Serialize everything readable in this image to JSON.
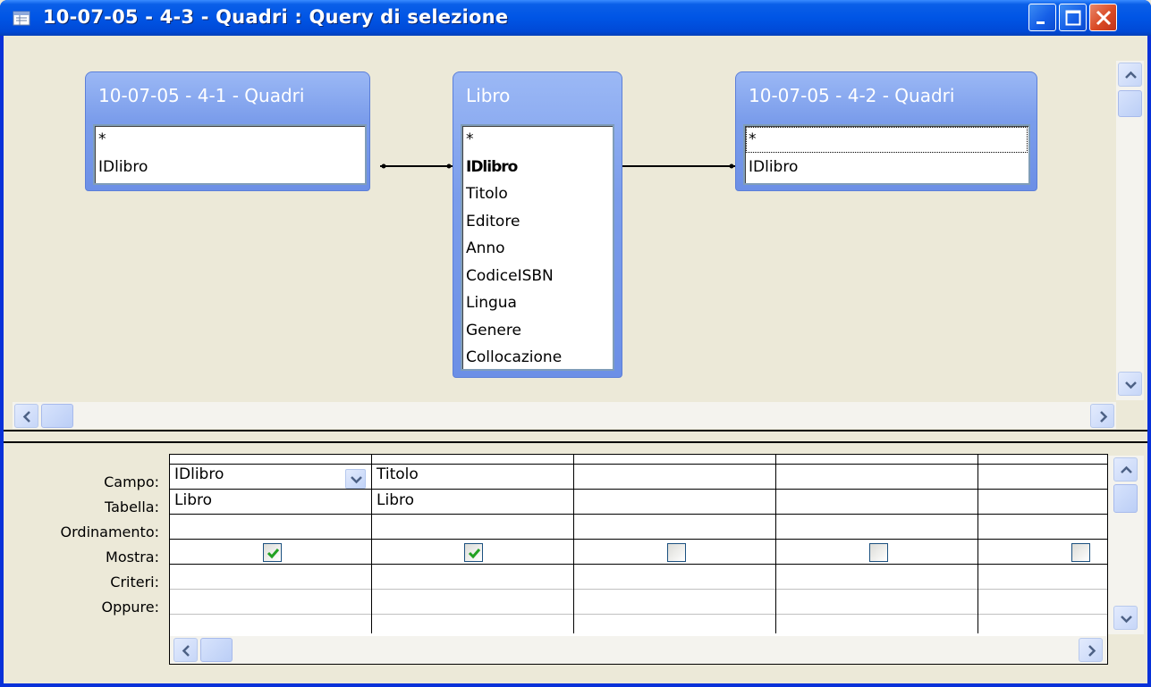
{
  "window": {
    "title": "10-07-05 - 4-3 - Quadri : Query di selezione",
    "colors": {
      "titlebar": "#0055E5",
      "close": "#DA4A25",
      "table_header": "#7B9DEB"
    }
  },
  "tables": [
    {
      "title": "10-07-05 - 4-1 - Quadri",
      "fields": [
        "*",
        "IDlibro"
      ]
    },
    {
      "title": "Libro",
      "fields": [
        "*",
        "IDlibro",
        "Titolo",
        "Editore",
        "Anno",
        "CodiceISBN",
        "Lingua",
        "Genere",
        "Collocazione"
      ]
    },
    {
      "title": "10-07-05 - 4-2 - Quadri",
      "fields": [
        "*",
        "IDlibro"
      ]
    }
  ],
  "grid": {
    "row_labels": [
      "Campo:",
      "Tabella:",
      "Ordinamento:",
      "Mostra:",
      "Criteri:",
      "Oppure:"
    ],
    "columns": [
      {
        "field": "IDlibro",
        "table": "Libro",
        "show": true
      },
      {
        "field": "Titolo",
        "table": "Libro",
        "show": true
      },
      {
        "field": "",
        "table": "",
        "show": false
      },
      {
        "field": "",
        "table": "",
        "show": false
      },
      {
        "field": "",
        "table": "",
        "show": false
      }
    ]
  },
  "icons": {
    "window_icon": "query-icon",
    "minimize": "minimize-icon",
    "maximize": "maximize-icon",
    "close": "close-icon",
    "dropdown": "chevron-down-icon",
    "check": "checkmark-icon"
  }
}
